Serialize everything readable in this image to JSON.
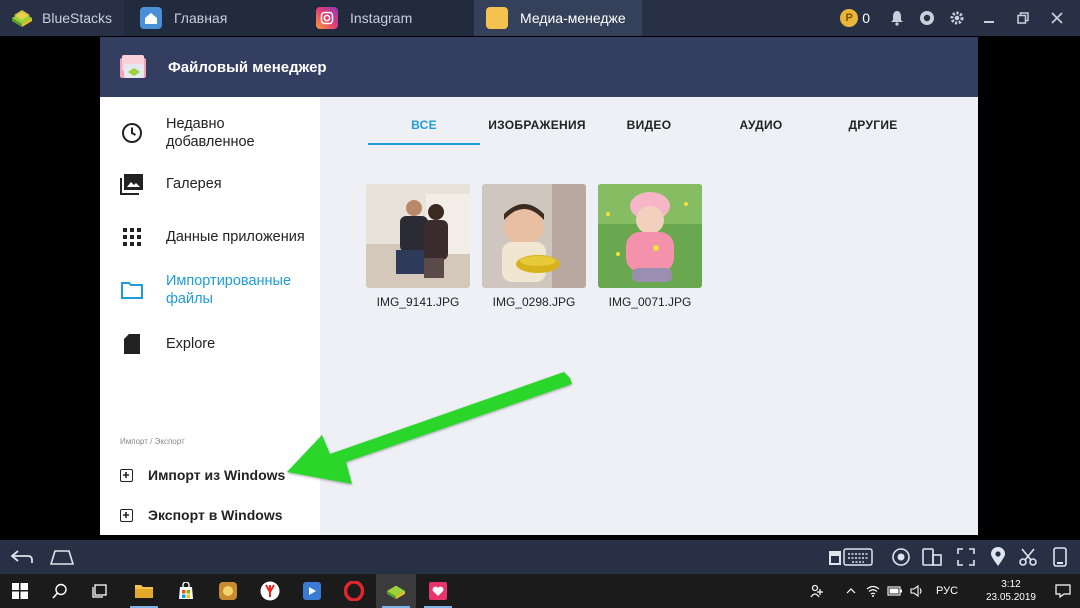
{
  "titlebar": {
    "tabs": [
      {
        "label": "BlueStacks"
      },
      {
        "label": "Главная"
      },
      {
        "label": "Instagram"
      },
      {
        "label": "Медиа-менедже"
      }
    ],
    "coins": "0"
  },
  "app": {
    "title": "Файловый менеджер",
    "accent": "#1f9dd6",
    "header_color": "#343e61"
  },
  "drawer": {
    "items": [
      {
        "label": "Недавно добавленное",
        "icon": "clock-icon"
      },
      {
        "label": "Галерея",
        "icon": "gallery-icon"
      },
      {
        "label": "Данные приложения",
        "icon": "apps-grid-icon"
      },
      {
        "label": "Импортированные файлы",
        "icon": "folder-icon",
        "active": true
      },
      {
        "label": "Explore",
        "icon": "sd-card-icon"
      }
    ],
    "section_label": "Импорт / Экспорт",
    "actions": [
      {
        "label": "Импорт из Windows"
      },
      {
        "label": "Экспорт в Windows"
      }
    ]
  },
  "filter_tabs": [
    {
      "label": "ВСЕ",
      "active": true
    },
    {
      "label": "ИЗОБРАЖЕНИЯ"
    },
    {
      "label": "ВИДЕО"
    },
    {
      "label": "АУДИО"
    },
    {
      "label": "ДРУГИЕ"
    }
  ],
  "files": [
    {
      "name": "IMG_9141.JPG"
    },
    {
      "name": "IMG_0298.JPG"
    },
    {
      "name": "IMG_0071.JPG"
    }
  ],
  "taskbar": {
    "language": "РУС",
    "time": "3:12",
    "date": "23.05.2019"
  }
}
